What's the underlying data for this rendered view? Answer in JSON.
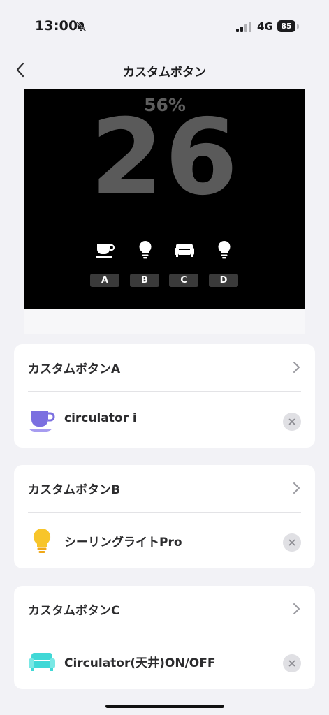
{
  "status": {
    "time": "13:00",
    "network": "4G",
    "battery": "85",
    "bell_icon": "bell-slash-icon",
    "signal_icon": "signal-bars-icon"
  },
  "nav": {
    "title": "カスタムボタン",
    "back_icon": "chevron-left-icon"
  },
  "preview": {
    "percent": "56%",
    "value": "26",
    "slots": [
      {
        "label": "A",
        "icon": "coffee-cup-icon"
      },
      {
        "label": "B",
        "icon": "lightbulb-icon"
      },
      {
        "label": "C",
        "icon": "sofa-icon"
      },
      {
        "label": "D",
        "icon": "lightbulb-icon"
      }
    ]
  },
  "cards": [
    {
      "title": "カスタムボタンA",
      "device": "circulator i",
      "device_icon": "coffee-cup-icon",
      "icon_color": "#7b6fe0"
    },
    {
      "title": "カスタムボタンB",
      "device": "シーリングライトPro",
      "device_icon": "lightbulb-icon",
      "icon_color": "#f7c52a"
    },
    {
      "title": "カスタムボタンC",
      "device": "Circulator(天井)ON/OFF",
      "device_icon": "sofa-icon",
      "icon_color": "#40d8d6"
    }
  ],
  "colors": {
    "background": "#f2f2f6",
    "preview_bg": "#000000",
    "preview_text": "#5a5a5a"
  }
}
